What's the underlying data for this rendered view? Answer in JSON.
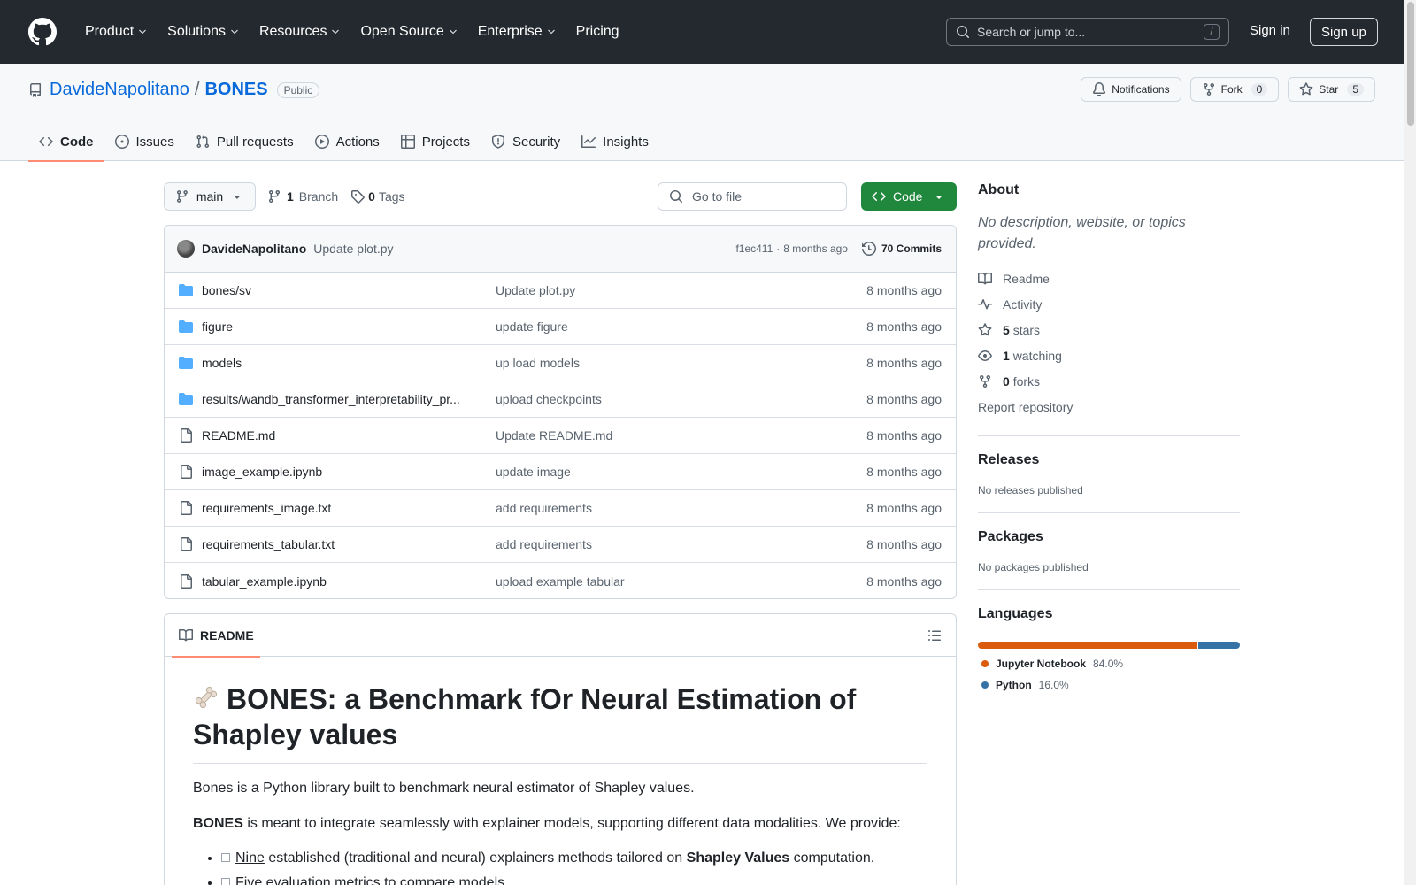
{
  "header": {
    "nav": [
      "Product",
      "Solutions",
      "Resources",
      "Open Source",
      "Enterprise",
      "Pricing"
    ],
    "search_placeholder": "Search or jump to...",
    "search_shortcut": "/",
    "sign_in": "Sign in",
    "sign_up": "Sign up"
  },
  "repo": {
    "owner": "DavideNapolitano",
    "separator": "/",
    "name": "BONES",
    "visibility": "Public",
    "notifications_label": "Notifications",
    "fork_label": "Fork",
    "fork_count": "0",
    "star_label": "Star",
    "star_count": "5",
    "tabs": [
      "Code",
      "Issues",
      "Pull requests",
      "Actions",
      "Projects",
      "Security",
      "Insights"
    ]
  },
  "toolbar": {
    "branch": "main",
    "branch_count": "1",
    "branch_label": "Branch",
    "tag_count": "0",
    "tag_label": "Tags",
    "goto_placeholder": "Go to file",
    "code_label": "Code"
  },
  "commit": {
    "author": "DavideNapolitano",
    "message": "Update plot.py",
    "hash": "f1ec411",
    "dot": "·",
    "time": "8 months ago",
    "commits_label": "70 Commits"
  },
  "files": [
    {
      "type": "dir",
      "name": "bones/sv",
      "message": "Update plot.py",
      "time": "8 months ago"
    },
    {
      "type": "dir",
      "name": "figure",
      "message": "update figure",
      "time": "8 months ago"
    },
    {
      "type": "dir",
      "name": "models",
      "message": "up load models",
      "time": "8 months ago"
    },
    {
      "type": "dir",
      "name": "results/wandb_transformer_interpretability_pr...",
      "message": "upload checkpoints",
      "time": "8 months ago"
    },
    {
      "type": "file",
      "name": "README.md",
      "message": "Update README.md",
      "time": "8 months ago"
    },
    {
      "type": "file",
      "name": "image_example.ipynb",
      "message": "update image",
      "time": "8 months ago"
    },
    {
      "type": "file",
      "name": "requirements_image.txt",
      "message": "add requirements",
      "time": "8 months ago"
    },
    {
      "type": "file",
      "name": "requirements_tabular.txt",
      "message": "add requirements",
      "time": "8 months ago"
    },
    {
      "type": "file",
      "name": "tabular_example.ipynb",
      "message": "upload example tabular",
      "time": "8 months ago"
    }
  ],
  "readme": {
    "tab_label": "README",
    "title": "BONES: a Benchmark fOr Neural Estimation of Shapley values",
    "intro": "Bones is a Python library built to benchmark neural estimator of Shapley values.",
    "p2_bold": "BONES",
    "p2_rest": " is meant to integrate seamlessly with explainer models, supporting different data modalities. We provide:",
    "li1_link": "Nine",
    "li1_mid": " established (traditional and neural) explainers methods tailored on ",
    "li1_bold": "Shapley Values",
    "li1_end": " computation.",
    "li2": "Five evaluation metrics to compare models."
  },
  "sidebar": {
    "about_title": "About",
    "about_desc": "No description, website, or topics provided.",
    "readme": "Readme",
    "activity": "Activity",
    "stars_count": "5",
    "stars_label": "stars",
    "watching_count": "1",
    "watching_label": "watching",
    "forks_count": "0",
    "forks_label": "forks",
    "report": "Report repository",
    "releases_title": "Releases",
    "releases_empty": "No releases published",
    "packages_title": "Packages",
    "packages_empty": "No packages published",
    "languages_title": "Languages",
    "languages": [
      {
        "name": "Jupyter Notebook",
        "percent": "84.0%",
        "value": 84.0,
        "color": "#DA5B0B"
      },
      {
        "name": "Python",
        "percent": "16.0%",
        "value": 16.0,
        "color": "#3572A5"
      }
    ]
  },
  "colors": {
    "header_bg": "#24292f",
    "link": "#0969da",
    "code_button": "#1f883d",
    "tab_underline": "#fd8c73",
    "folder": "#54aeff"
  }
}
